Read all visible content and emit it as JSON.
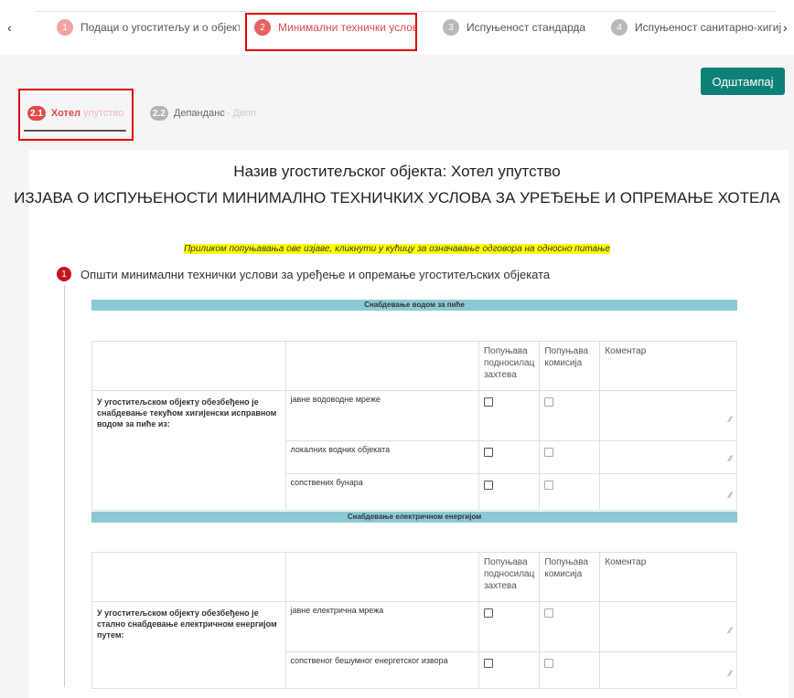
{
  "steps": [
    {
      "num": "1",
      "label": "Подаци о угоститељу и о објекту"
    },
    {
      "num": "2",
      "label": "Минимални технички услови"
    },
    {
      "num": "3",
      "label": "Испуњеност стандарда"
    },
    {
      "num": "4",
      "label": "Испуњеност санитарно-хигијен"
    }
  ],
  "nav": {
    "prev": "‹",
    "next": "›"
  },
  "print_label": "Одштампај",
  "subtabs": [
    {
      "num": "2.1",
      "label": "Хотел",
      "suffix": "упутство"
    },
    {
      "num": "2.2",
      "label": "Депанданс",
      "suffix": " - Депп"
    }
  ],
  "title": "Назив угоститељског објекта: Хотел упутство",
  "subtitle": "ИЗЈАВА О ИСПУЊЕНОСТИ МИНИМАЛНО ТЕХНИЧКИХ УСЛОВА ЗА УРЕЂЕЊЕ И ОПРЕМАЊЕ ХОТЕЛА",
  "instruction": "Приликом попуњавања ове изјаве, кликнути у кућицу за означавање одговора на односно питање",
  "section": {
    "num": "1",
    "title": "Општи минимални технички услови за уређење и опремање угоститељских објеката"
  },
  "headers": {
    "applicant": "Попуњава подносилац захтева",
    "commission": "Попуњава комисија",
    "comment": "Коментар"
  },
  "groups": [
    {
      "band": "Снабдевање водом за пиће",
      "question": "У угоститељском објекту обезбеђено је снабдевање текућом хигијенски исправном водом за пиће из:",
      "options": [
        "јавне водоводне мреже",
        "локалних водних објеката",
        "сопствених бунара"
      ]
    },
    {
      "band": "Снабдевање електричном енергијом",
      "question": "У угоститељском објекту обезбеђено је стално снабдевање електричном енергијом путем:",
      "options": [
        "јавне електрична мрежа",
        "сопственог бешумног енергетског извора"
      ]
    }
  ]
}
